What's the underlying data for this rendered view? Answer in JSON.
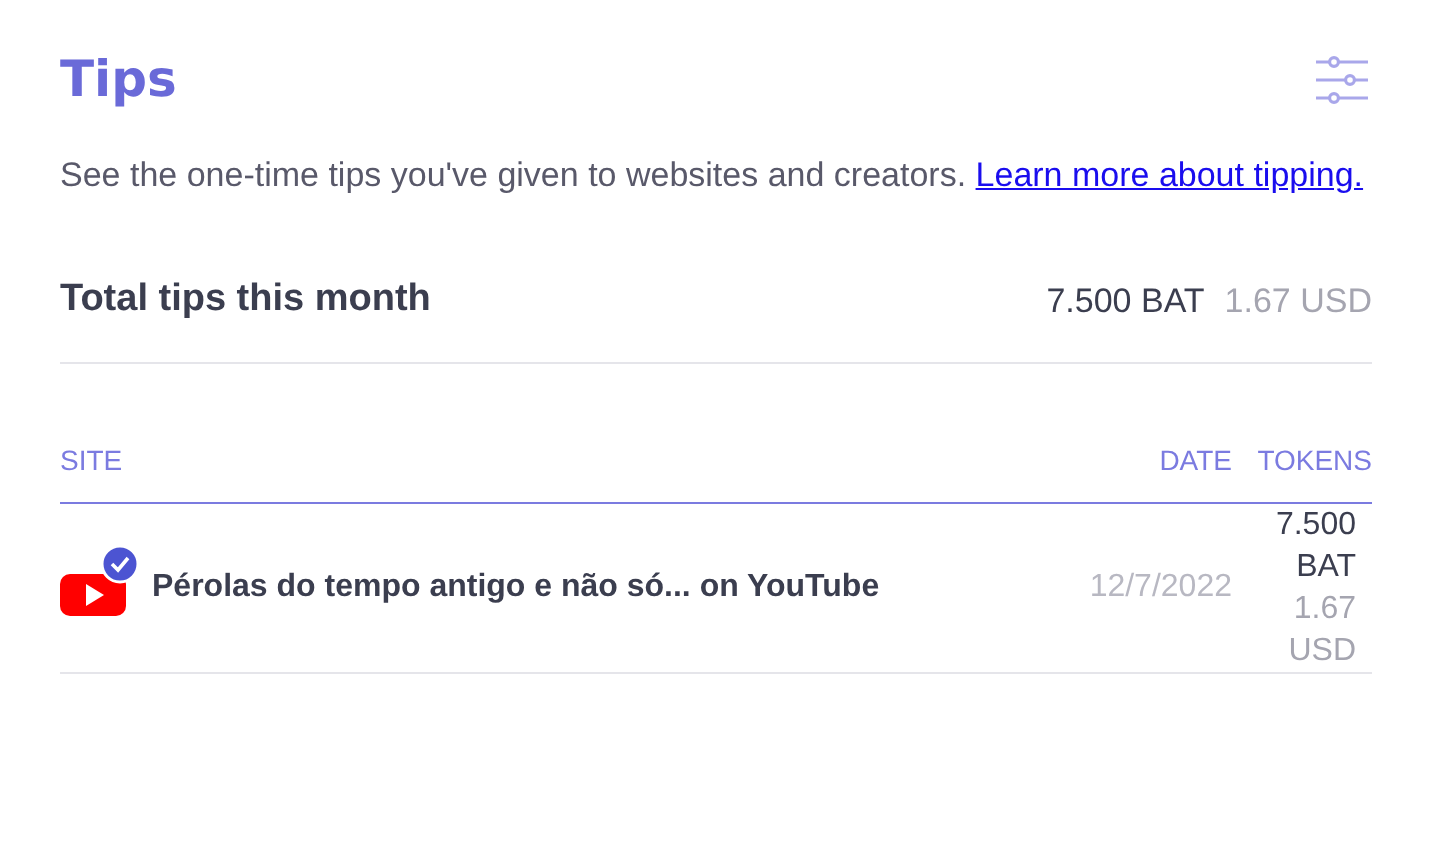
{
  "header": {
    "title": "Tips"
  },
  "description": {
    "text": "See the one-time tips you've given to websites and creators.",
    "link": "Learn more about tipping."
  },
  "summary": {
    "label": "Total tips this month",
    "bat": "7.500 BAT",
    "usd": "1.67 USD"
  },
  "table": {
    "columns": [
      "SITE",
      "DATE",
      "TOKENS"
    ],
    "rows": [
      {
        "site": "Pérolas do tempo antigo e não só... on YouTube",
        "verified": true,
        "date": "12/7/2022",
        "bat": "7.500 BAT",
        "usd": "1.67 USD"
      }
    ]
  }
}
